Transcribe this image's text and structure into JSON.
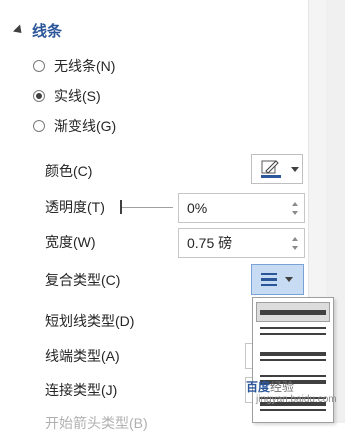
{
  "section": {
    "title": "线条"
  },
  "line_options": [
    {
      "label": "无线条(N)",
      "checked": false
    },
    {
      "label": "实线(S)",
      "checked": true
    },
    {
      "label": "渐变线(G)",
      "checked": false
    }
  ],
  "properties": {
    "color": {
      "label": "颜色(C)",
      "icon": "pen-color-icon",
      "accent": "#2b579a"
    },
    "transparency": {
      "label": "透明度(T)",
      "value": "0%",
      "slider_level": 0
    },
    "width": {
      "label": "宽度(W)",
      "value": "0.75 磅"
    },
    "compound_type": {
      "label": "复合类型(C)"
    },
    "dash_type": {
      "label": "短划线类型(D)"
    },
    "cap_type": {
      "label": "线端类型(A)"
    },
    "join_type": {
      "label": "连接类型(J)"
    },
    "begin_arrow": {
      "label": "开始箭头类型(B)"
    }
  },
  "compound_menu": {
    "options": [
      "single",
      "double",
      "thick-thin",
      "thin-thick",
      "triple"
    ],
    "selected": "single"
  },
  "watermark": {
    "brand": "百度",
    "text": "经验",
    "sub": "jingyan.baidu.com"
  },
  "colors": {
    "accent": "#2b579a",
    "selected_bg": "#c7dcf2"
  }
}
